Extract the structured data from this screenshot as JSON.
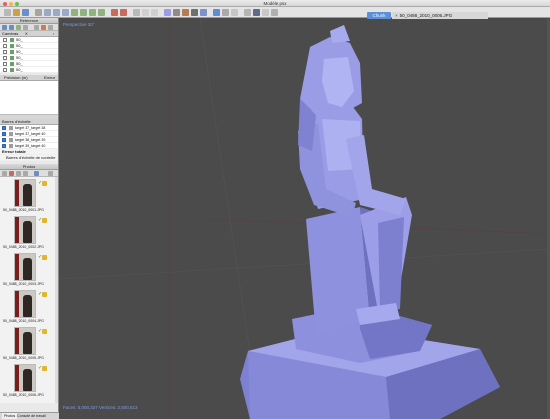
{
  "window": {
    "title": "Modèle.psx"
  },
  "viewport": {
    "tab_label": "Chunk",
    "photo_tab_label": "50_0488_2010_0006.JPG",
    "mode_label": "Perspective 30°",
    "stats_label": "Faces: 5,000,327 Vertices: 2,500,513"
  },
  "panels": {
    "reference_title": "Référence",
    "cameras_header": "Caméras",
    "cameras_col2": "X",
    "camera_rows": [
      "50_",
      "50_",
      "50_",
      "50_",
      "50_",
      "50_"
    ],
    "accuracy_header": "Précision (m)",
    "error_header": "Erreur",
    "scalebars_header": "Barres d'échelle",
    "scalebars": [
      "target 37_target 38",
      "target 37_target 40",
      "target 38_target 39",
      "target 39_target 40"
    ],
    "total_error_label": "Erreur totale",
    "control_bars_label": "Barres d'échelle de contrôle",
    "photos_title": "Photos",
    "photos": [
      "50_0488_2010_0001.JPG",
      "50_0488_2010_0002.JPG",
      "50_0488_2010_0003.JPG",
      "50_0488_2010_0004.JPG",
      "50_0488_2010_0005.JPG",
      "50_0488_2010_0006.JPG"
    ],
    "bottom_tabs": [
      "Photos",
      "Console de travail"
    ]
  },
  "colors": {
    "model": "#9b9de6",
    "model_shadow": "#6d70bd",
    "accent": "#5c8fd6",
    "viewport_bg": "#4b4b4b"
  }
}
